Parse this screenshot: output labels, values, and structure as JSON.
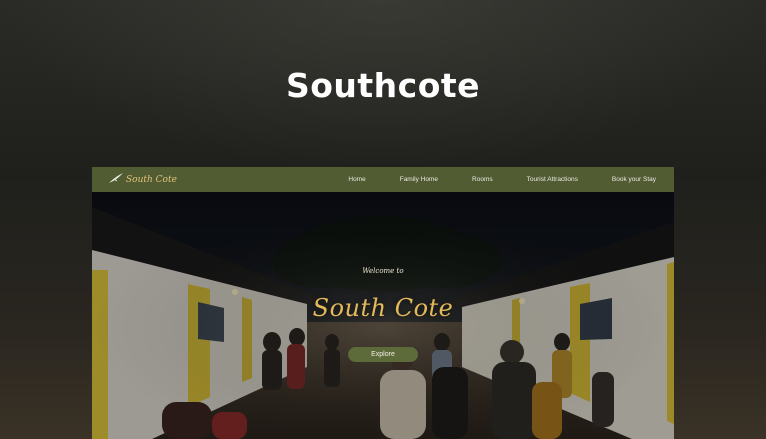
{
  "page": {
    "title": "Southcote"
  },
  "site": {
    "logo_text": "South Cote",
    "nav": [
      {
        "label": "Home"
      },
      {
        "label": "Family Home"
      },
      {
        "label": "Rooms"
      },
      {
        "label": "Tourist Attractions"
      },
      {
        "label": "Book your Stay"
      }
    ],
    "hero": {
      "welcome": "Welcome to",
      "title": "South Cote",
      "button_label": "Explore"
    }
  },
  "colors": {
    "navbar": "#525c33",
    "accent_gold": "#e3b95a",
    "button": "#5d6a3a"
  }
}
